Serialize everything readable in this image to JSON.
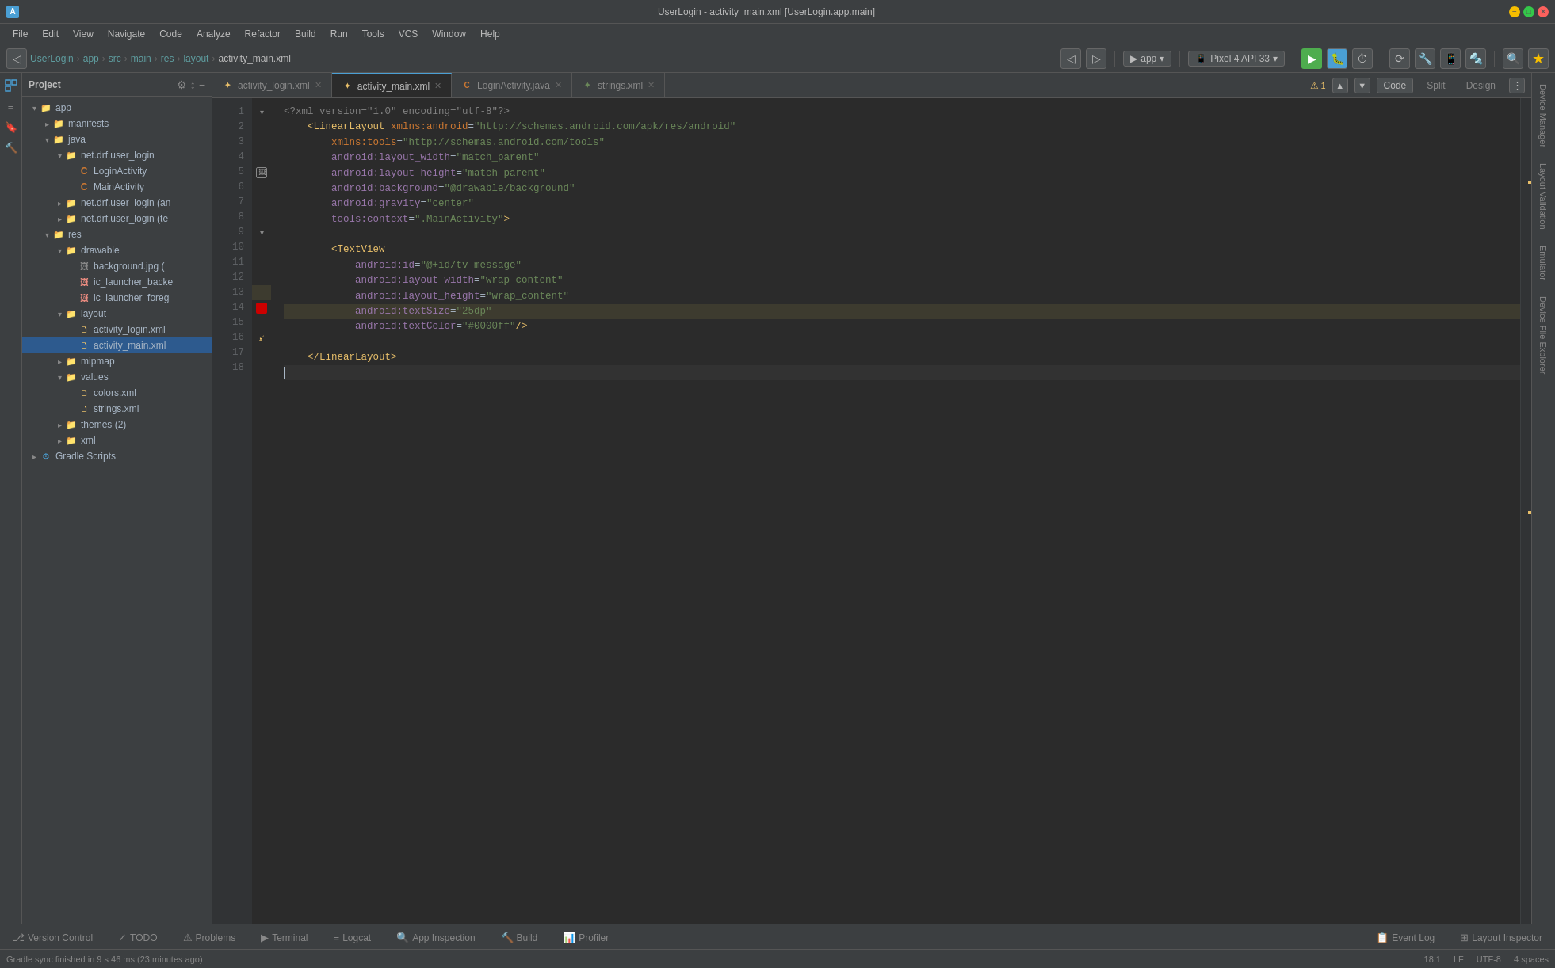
{
  "titleBar": {
    "title": "UserLogin - activity_main.xml [UserLogin.app.main]",
    "icon": "A"
  },
  "menuBar": {
    "items": [
      "File",
      "Edit",
      "View",
      "Navigate",
      "Code",
      "Analyze",
      "Refactor",
      "Build",
      "Run",
      "Tools",
      "VCS",
      "Window",
      "Help"
    ]
  },
  "navBar": {
    "breadcrumb": [
      "UserLogin",
      "app",
      "src",
      "main",
      "res",
      "layout",
      "activity_main.xml"
    ],
    "device": "app",
    "api": "Pixel 4 API 33"
  },
  "tabs": {
    "items": [
      {
        "label": "activity_login.xml",
        "type": "xml",
        "active": false
      },
      {
        "label": "activity_main.xml",
        "type": "xml",
        "active": true
      },
      {
        "label": "LoginActivity.java",
        "type": "java",
        "active": false
      },
      {
        "label": "strings.xml",
        "type": "str",
        "active": false
      }
    ],
    "viewModes": [
      "Code",
      "Split",
      "Design"
    ]
  },
  "editor": {
    "lines": [
      {
        "num": 1,
        "content": "<?xml version=\"1.0\" encoding=\"utf-8\"?>",
        "type": "normal"
      },
      {
        "num": 2,
        "content": "    <LinearLayout xmlns:android=\"http://schemas.android.com/apk/res/android\"",
        "type": "fold",
        "foldable": true
      },
      {
        "num": 3,
        "content": "        xmlns:tools=\"http://schemas.android.com/tools\"",
        "type": "normal"
      },
      {
        "num": 4,
        "content": "        android:layout_width=\"match_parent\"",
        "type": "normal"
      },
      {
        "num": 5,
        "content": "        android:layout_height=\"match_parent\"",
        "type": "normal"
      },
      {
        "num": 6,
        "content": "        android:background=\"@drawable/background\"",
        "type": "normal"
      },
      {
        "num": 7,
        "content": "        android:gravity=\"center\"",
        "type": "normal"
      },
      {
        "num": 8,
        "content": "        tools:context=\".MainActivity\">",
        "type": "normal"
      },
      {
        "num": 9,
        "content": "",
        "type": "normal"
      },
      {
        "num": 10,
        "content": "        <TextView",
        "type": "fold",
        "foldable": true
      },
      {
        "num": 11,
        "content": "            android:id=\"@+id/tv_message\"",
        "type": "normal"
      },
      {
        "num": 12,
        "content": "            android:layout_width=\"wrap_content\"",
        "type": "normal"
      },
      {
        "num": 13,
        "content": "            android:layout_height=\"wrap_content\"",
        "type": "normal"
      },
      {
        "num": 14,
        "content": "            android:textSize=\"25dp\"",
        "type": "highlighted"
      },
      {
        "num": 15,
        "content": "            android:textColor=\"#0000ff\"/>",
        "type": "normal",
        "breakpoint": true
      },
      {
        "num": 16,
        "content": "",
        "type": "normal"
      },
      {
        "num": 17,
        "content": "    </LinearLayout>",
        "type": "normal"
      },
      {
        "num": 18,
        "content": "",
        "type": "current"
      }
    ]
  },
  "projectPanel": {
    "title": "Project",
    "rootLabel": "app",
    "tree": [
      {
        "level": 0,
        "label": "app",
        "type": "folder",
        "expanded": true
      },
      {
        "level": 1,
        "label": "manifests",
        "type": "folder",
        "expanded": false
      },
      {
        "level": 1,
        "label": "java",
        "type": "folder",
        "expanded": true
      },
      {
        "level": 2,
        "label": "net.drf.user_login",
        "type": "folder",
        "expanded": true
      },
      {
        "level": 3,
        "label": "LoginActivity",
        "type": "java"
      },
      {
        "level": 3,
        "label": "MainActivity",
        "type": "java"
      },
      {
        "level": 2,
        "label": "net.drf.user_login (an",
        "type": "folder",
        "expanded": false
      },
      {
        "level": 2,
        "label": "net.drf.user_login (te",
        "type": "folder",
        "expanded": false
      },
      {
        "level": 1,
        "label": "res",
        "type": "folder",
        "expanded": true
      },
      {
        "level": 2,
        "label": "drawable",
        "type": "folder",
        "expanded": true
      },
      {
        "level": 3,
        "label": "background.jpg (",
        "type": "file"
      },
      {
        "level": 3,
        "label": "ic_launcher_backe",
        "type": "file"
      },
      {
        "level": 3,
        "label": "ic_launcher_foreg",
        "type": "file"
      },
      {
        "level": 2,
        "label": "layout",
        "type": "folder",
        "expanded": true
      },
      {
        "level": 3,
        "label": "activity_login.xml",
        "type": "xml"
      },
      {
        "level": 3,
        "label": "activity_main.xml",
        "type": "xml",
        "selected": true
      },
      {
        "level": 2,
        "label": "mipmap",
        "type": "folder",
        "expanded": false
      },
      {
        "level": 2,
        "label": "values",
        "type": "folder",
        "expanded": true
      },
      {
        "level": 3,
        "label": "colors.xml",
        "type": "xml"
      },
      {
        "level": 3,
        "label": "strings.xml",
        "type": "xml"
      },
      {
        "level": 2,
        "label": "themes (2)",
        "type": "folder",
        "expanded": false
      },
      {
        "level": 2,
        "label": "xml",
        "type": "folder",
        "expanded": false
      },
      {
        "level": 0,
        "label": "Gradle Scripts",
        "type": "gradle",
        "expanded": false
      }
    ]
  },
  "rightPanels": {
    "tabs": [
      "Device Manager",
      "Layout Validation",
      "Emulator",
      "Device File Explorer"
    ]
  },
  "bottomTabs": {
    "items": [
      {
        "label": "Version Control",
        "icon": "⎇",
        "active": false
      },
      {
        "label": "TODO",
        "icon": "✓",
        "active": false
      },
      {
        "label": "Problems",
        "icon": "⚠",
        "active": false
      },
      {
        "label": "Terminal",
        "icon": ">_",
        "active": false
      },
      {
        "label": "Logcat",
        "icon": "≡",
        "active": false
      },
      {
        "label": "App Inspection",
        "icon": "🔍",
        "active": false
      },
      {
        "label": "Build",
        "icon": "🔨",
        "active": false
      },
      {
        "label": "Profiler",
        "icon": "📊",
        "active": false
      }
    ],
    "rightItems": [
      {
        "label": "Event Log",
        "icon": "📋"
      },
      {
        "label": "Layout Inspector",
        "icon": "⊞"
      }
    ]
  },
  "statusBar": {
    "message": "Gradle sync finished in 9 s 46 ms (23 minutes ago)",
    "position": "18:1",
    "lineEnding": "LF",
    "encoding": "UTF-8",
    "indent": "4 spaces"
  },
  "warningBadge": "1"
}
